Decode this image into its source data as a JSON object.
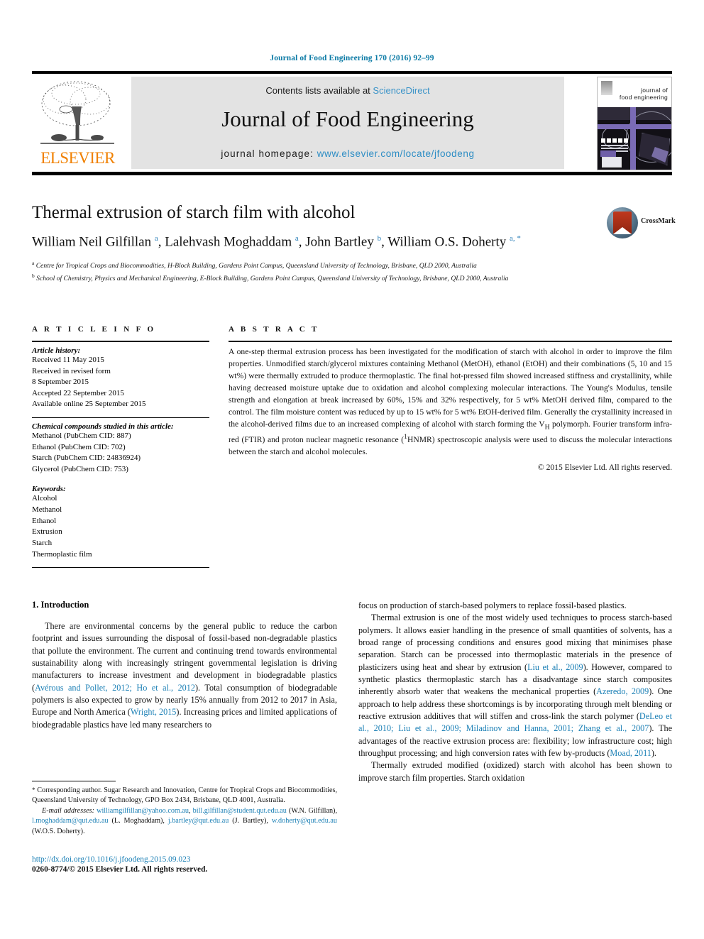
{
  "running_head": "Journal of Food Engineering 170 (2016) 92–99",
  "masthead": {
    "contents_prefix": "Contents lists available at ",
    "sciencedirect": "ScienceDirect",
    "journal_title": "Journal of Food Engineering",
    "homepage_label": "journal homepage:",
    "homepage_url": "www.elsevier.com/locate/jfoodeng",
    "publisher_wordmark": "ELSEVIER",
    "cover_title_line1": "journal of",
    "cover_title_line2": "food engineering"
  },
  "article": {
    "title": "Thermal extrusion of starch film with alcohol",
    "authors_html": "William Neil Gilfillan <sup>a</sup>, Lalehvash Moghaddam <sup>a</sup>, John Bartley <sup>b</sup>, William O.S. Doherty <sup>a, *</sup>",
    "affiliation_a": "Centre for Tropical Crops and Biocommodities, H-Block Building, Gardens Point Campus, Queensland University of Technology, Brisbane, QLD 2000, Australia",
    "affiliation_b": "School of Chemistry, Physics and Mechanical Engineering, E-Block Building, Gardens Point Campus, Queensland University of Technology, Brisbane, QLD 2000, Australia",
    "crossmark_label": "CrossMark"
  },
  "article_info": {
    "heading": "A R T I C L E  I N F O",
    "history_label": "Article history:",
    "history": [
      "Received 11 May 2015",
      "Received in revised form",
      "8 September 2015",
      "Accepted 22 September 2015",
      "Available online 25 September 2015"
    ],
    "compounds_label": "Chemical compounds studied in this article:",
    "compounds": [
      "Methanol (PubChem CID: 887)",
      "Ethanol (PubChem CID: 702)",
      "Starch (PubChem CID: 24836924)",
      "Glycerol (PubChem CID: 753)"
    ],
    "keywords_label": "Keywords:",
    "keywords": [
      "Alcohol",
      "Methanol",
      "Ethanol",
      "Extrusion",
      "Starch",
      "Thermoplastic film"
    ]
  },
  "abstract": {
    "heading": "A B S T R A C T",
    "text": "A one-step thermal extrusion process has been investigated for the modification of starch with alcohol in order to improve the film properties. Unmodified starch/glycerol mixtures containing Methanol (MetOH), ethanol (EtOH) and their combinations (5, 10 and 15 wt%) were thermally extruded to produce thermoplastic. The final hot-pressed film showed increased stiffness and crystallinity, while having decreased moisture uptake due to oxidation and alcohol complexing molecular interactions. The Young's Modulus, tensile strength and elongation at break increased by 60%, 15% and 32% respectively, for 5 wt% MetOH derived film, compared to the control. The film moisture content was reduced by up to 15 wt% for 5 wt% EtOH-derived film. Generally the crystallinity increased in the alcohol-derived films due to an increased complexing of alcohol with starch forming the V",
    "text_sub": "H",
    "text2": " polymorph. Fourier transform infra-red (FTIR) and proton nuclear magnetic resonance (",
    "text_sup": "1",
    "text3": "HNMR) spectroscopic analysis were used to discuss the molecular interactions between the starch and alcohol molecules.",
    "copyright": "© 2015 Elsevier Ltd. All rights reserved."
  },
  "body": {
    "section_heading": "1. Introduction",
    "left_p1_a": "There are environmental concerns by the general public to reduce the carbon footprint and issues surrounding the disposal of fossil-based non-degradable plastics that pollute the environment. The current and continuing trend towards environmental sustainability along with increasingly stringent governmental legislation is driving manufacturers to increase investment and development in biodegradable plastics (",
    "left_p1_ref1": "Avérous and Pollet, 2012; Ho et al., 2012",
    "left_p1_b": "). Total consumption of biodegradable polymers is also expected to grow by nearly 15% annually from 2012 to 2017 in Asia, Europe and North America (",
    "left_p1_ref2": "Wright, 2015",
    "left_p1_c": "). Increasing prices and limited applications of biodegradable plastics have led many researchers to",
    "right_p1": "focus on production of starch-based polymers to replace fossil-based plastics.",
    "right_p2_a": "Thermal extrusion is one of the most widely used techniques to process starch-based polymers. It allows easier handling in the presence of small quantities of solvents, has a broad range of processing conditions and ensures good mixing that minimises phase separation. Starch can be processed into thermoplastic materials in the presence of plasticizers using heat and shear by extrusion (",
    "right_p2_ref1": "Liu et al., 2009",
    "right_p2_b": "). However, compared to synthetic plastics thermoplastic starch has a disadvantage since starch composites inherently absorb water that weakens the mechanical properties (",
    "right_p2_ref2": "Azeredo, 2009",
    "right_p2_c": "). One approach to help address these shortcomings is by incorporating through melt blending or reactive extrusion additives that will stiffen and cross-link the starch polymer (",
    "right_p2_ref3": "DeLeo et al., 2010; Liu et al., 2009; Miladinov and Hanna, 2001; Zhang et al., 2007",
    "right_p2_d": "). The advantages of the reactive extrusion process are: flexibility; low infrastructure cost; high throughput processing; and high conversion rates with few by-products (",
    "right_p2_ref4": "Moad, 2011",
    "right_p2_e": ").",
    "right_p3": "Thermally extruded modified (oxidized) starch with alcohol has been shown to improve starch film properties. Starch oxidation"
  },
  "footnote": {
    "star": "*",
    "corresponding_a": " Corresponding author. Sugar Research and Innovation, Centre for Tropical Crops and Biocommodities, Queensland University of Technology, GPO Box 2434, Brisbane, QLD 4001, Australia.",
    "email_label": "E-mail addresses:",
    "email1": "williamgilfillan@yahoo.com.au",
    "email2": "bill.gilfillan@student.qut.edu.au",
    "email1_owner": " (W.N. Gilfillan), ",
    "email3": "l.moghaddam@qut.edu.au",
    "email3_owner": " (L. Moghaddam), ",
    "email4": "j.bartley@qut.edu.au",
    "email4_owner": " (J. Bartley), ",
    "email5": "w.doherty@qut.edu.au",
    "email5_owner": " (W.O.S. Doherty)."
  },
  "doi": {
    "url": "http://dx.doi.org/10.1016/j.jfoodeng.2015.09.023",
    "issn_line": "0260-8774/© 2015 Elsevier Ltd. All rights reserved."
  },
  "colors": {
    "link_teal": "#1a7fb5",
    "running_head": "#0b7aa5",
    "sciencedirect_blue": "#3a93c8",
    "elsevier_orange": "#f08000",
    "affil_sup_blue": "#2b7fb8"
  }
}
